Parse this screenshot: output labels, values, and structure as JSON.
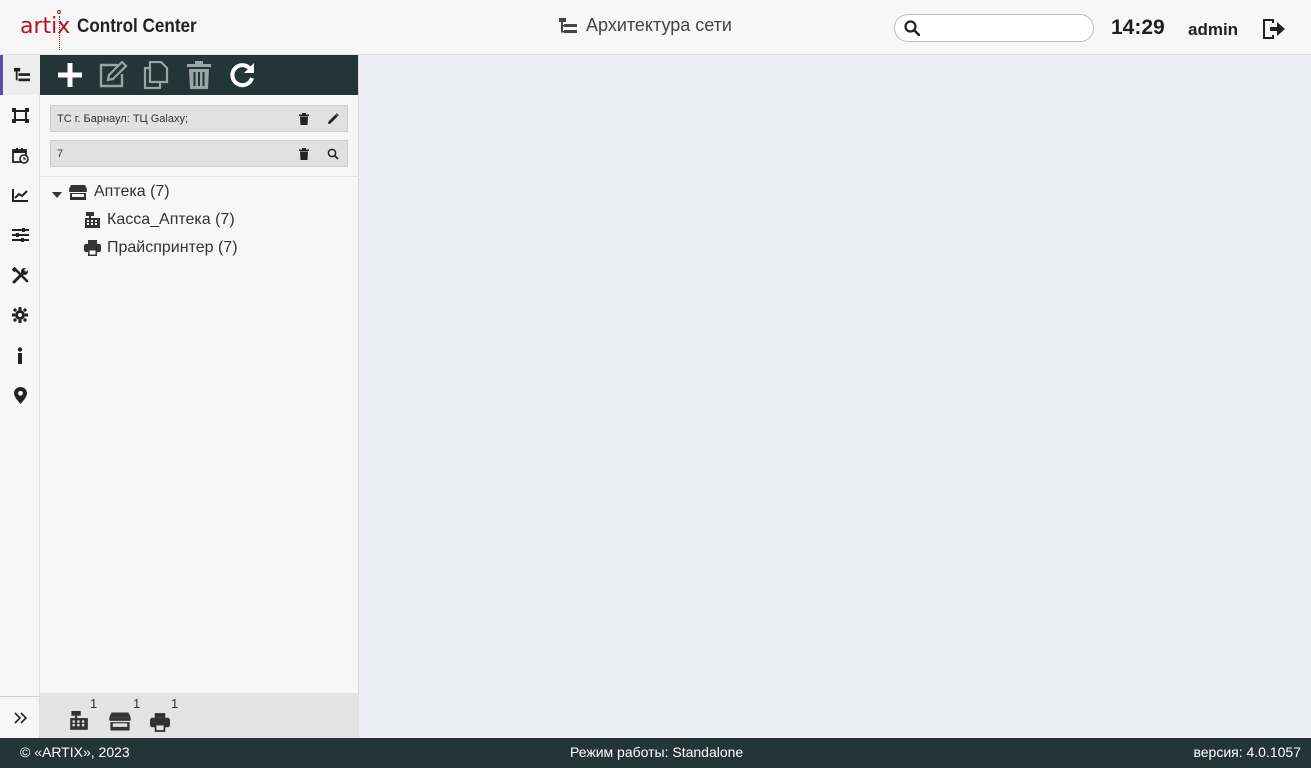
{
  "header": {
    "logo_text": "artix",
    "app_name": "Control Center",
    "page_title": "Архитектура сети",
    "search": {
      "value": "",
      "placeholder": ""
    },
    "time": "14:29",
    "user": "admin"
  },
  "rail": {
    "items": [
      {
        "name": "network-architecture",
        "icon": "tree-structure-icon",
        "active": true
      },
      {
        "name": "devices",
        "icon": "frame-icon"
      },
      {
        "name": "schedule",
        "icon": "calendar-clock-icon"
      },
      {
        "name": "reports",
        "icon": "chart-line-icon"
      },
      {
        "name": "filters",
        "icon": "sliders-icon"
      },
      {
        "name": "tools",
        "icon": "wrench-screwdriver-icon"
      },
      {
        "name": "settings",
        "icon": "gear-icon"
      },
      {
        "name": "info",
        "icon": "info-icon"
      },
      {
        "name": "location",
        "icon": "map-pin-icon"
      }
    ],
    "expand_icon": "double-chevron-right-icon"
  },
  "toolbar": {
    "buttons": [
      "plus-icon",
      "edit-icon",
      "copy-icon",
      "trash-icon",
      "refresh-icon"
    ]
  },
  "filters": {
    "location": "ТС г. Барнаул: ТЦ Galaxy;",
    "query": "7"
  },
  "tree": {
    "root": {
      "label": "Аптека (7)",
      "icon": "store-icon",
      "expanded": true
    },
    "children": [
      {
        "label": "Касса_Аптека (7)",
        "icon": "cash-register-icon"
      },
      {
        "label": "Прайспринтер (7)",
        "icon": "printer-icon"
      }
    ]
  },
  "panel_footer": {
    "counters": [
      {
        "icon": "cash-register-icon",
        "count": "1"
      },
      {
        "icon": "store-icon",
        "count": "1"
      },
      {
        "icon": "printer-icon",
        "count": "1"
      }
    ]
  },
  "footer": {
    "copyright": "© «ARTIX», 2023",
    "mode": "Режим работы: Standalone",
    "version": "версия: 4.0.1057"
  },
  "colors": {
    "toolbar_bg": "#233534",
    "footer_bg": "#233534",
    "brand_red": "#b5121b",
    "active_accent": "#5a4fb0",
    "content_bg": "#eceef1"
  }
}
